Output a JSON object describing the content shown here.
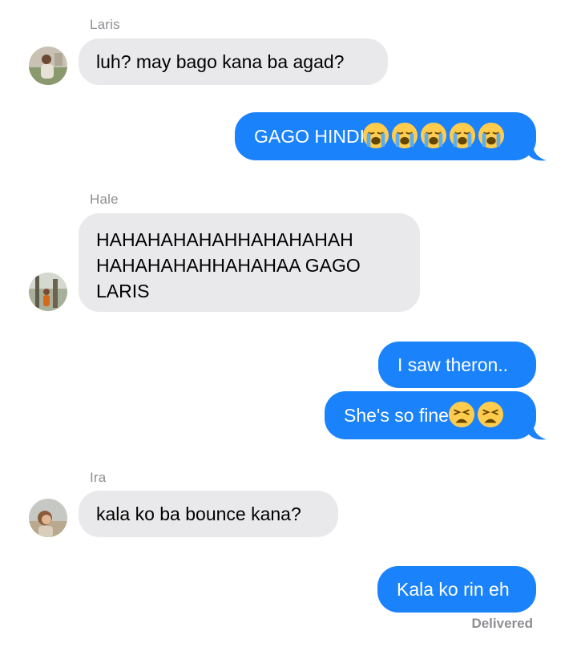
{
  "conversation": {
    "messages": [
      {
        "sender": "Laris",
        "text": "luh? may bago kana ba agad?"
      },
      {
        "text": "GAGO HINDI",
        "emoji": [
          "loudly-crying-face",
          "loudly-crying-face",
          "loudly-crying-face",
          "loudly-crying-face",
          "loudly-crying-face"
        ]
      },
      {
        "sender": "Hale",
        "line1": "HAHAHAHAHAHHAHAHAHAH",
        "line2": "HAHAHAHAHHAHAHAA GAGO",
        "line3": "LARIS"
      },
      {
        "text": "I saw theron.."
      },
      {
        "text": "She's so fine",
        "emoji": [
          "weary-face",
          "weary-face"
        ]
      },
      {
        "sender": "Ira",
        "text": "kala ko ba bounce kana?"
      },
      {
        "text": "Kala ko rin eh"
      }
    ],
    "status": "Delivered"
  },
  "colors": {
    "incoming_bubble": "#e9e9eb",
    "outgoing_bubble": "#1a82fb",
    "sender_label": "#8e8e93"
  }
}
